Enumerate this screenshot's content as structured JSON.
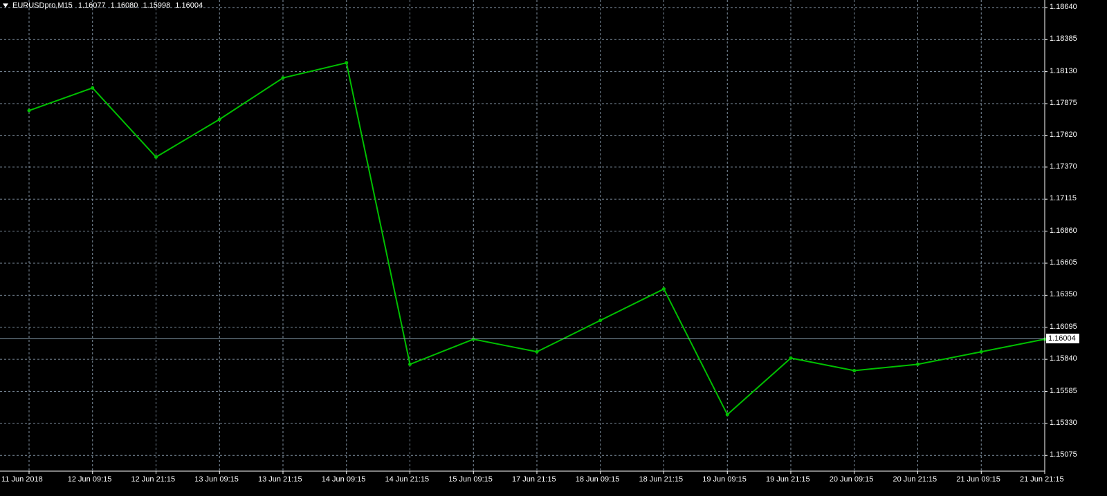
{
  "header": {
    "symbol": "EURUSDpro,M15",
    "open": "1.16077",
    "high": "1.16080",
    "low": "1.15998",
    "close": "1.16004"
  },
  "current_price": "1.16004",
  "colors": {
    "background": "#000000",
    "grid": "#7f8f9f",
    "price_bars": "#00c000",
    "axis_text": "#ffffff",
    "price_line": "#8aa0b0"
  },
  "chart_data": {
    "type": "line",
    "title": "",
    "symbol": "EURUSDpro",
    "timeframe": "M15",
    "grid": true,
    "ylim": [
      1.1495,
      1.187
    ],
    "y_ticks": [
      "1.18640",
      "1.18385",
      "1.18130",
      "1.17875",
      "1.17620",
      "1.17370",
      "1.17115",
      "1.16860",
      "1.16605",
      "1.16350",
      "1.16095",
      "1.15840",
      "1.15585",
      "1.15330",
      "1.15075"
    ],
    "x_ticks": [
      "11 Jun 2018",
      "12 Jun 09:15",
      "12 Jun 21:15",
      "13 Jun 09:15",
      "13 Jun 21:15",
      "14 Jun 09:15",
      "14 Jun 21:15",
      "15 Jun 09:15",
      "17 Jun 21:15",
      "18 Jun 09:15",
      "18 Jun 21:15",
      "19 Jun 09:15",
      "19 Jun 21:15",
      "20 Jun 09:15",
      "20 Jun 21:15",
      "21 Jun 09:15",
      "21 Jun 21:15"
    ],
    "series": [
      {
        "x": [
          "11 Jun 2018",
          "12 Jun 09:15",
          "12 Jun 21:15",
          "13 Jun 09:15",
          "13 Jun 21:15",
          "14 Jun 09:15",
          "14 Jun 21:15",
          "15 Jun 09:15",
          "17 Jun 21:15",
          "18 Jun 09:15",
          "18 Jun 21:15",
          "19 Jun 09:15",
          "19 Jun 21:15",
          "20 Jun 09:15",
          "20 Jun 21:15",
          "21 Jun 09:15",
          "21 Jun 21:15"
        ],
        "values": [
          1.1782,
          1.18,
          1.1745,
          1.1775,
          1.1808,
          1.182,
          1.158,
          1.16,
          1.159,
          1.1615,
          1.164,
          1.154,
          1.1585,
          1.1575,
          1.158,
          1.159,
          1.16
        ]
      }
    ]
  }
}
